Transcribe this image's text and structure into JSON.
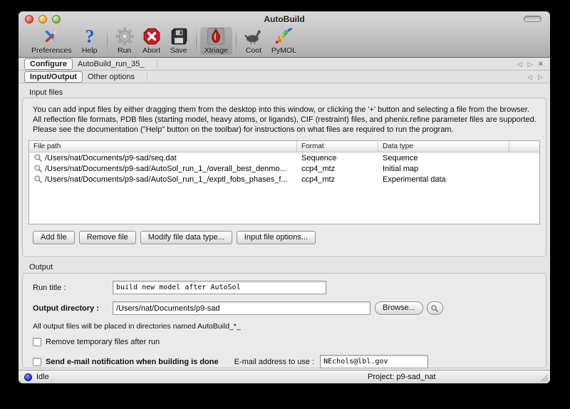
{
  "window": {
    "title": "AutoBuild"
  },
  "toolbar": {
    "items": [
      {
        "label": "Preferences",
        "icon": "preferences-icon"
      },
      {
        "label": "Help",
        "icon": "help-icon"
      },
      {
        "label": "Run",
        "icon": "run-icon"
      },
      {
        "label": "Abort",
        "icon": "abort-icon"
      },
      {
        "label": "Save",
        "icon": "save-icon"
      },
      {
        "label": "Xtriage",
        "icon": "xtriage-icon"
      },
      {
        "label": "Coot",
        "icon": "coot-icon"
      },
      {
        "label": "PyMOL",
        "icon": "pymol-icon"
      }
    ]
  },
  "icons": {
    "tab_prev": "◁",
    "tab_next": "▷",
    "tab_close": "×"
  },
  "tabs": {
    "main": [
      {
        "label": "Configure",
        "selected": true
      },
      {
        "label": "AutoBuild_run_35_",
        "selected": false
      }
    ],
    "sub": [
      {
        "label": "Input/Output",
        "selected": true
      },
      {
        "label": "Other options",
        "selected": false
      }
    ]
  },
  "input_files": {
    "group_label": "Input files",
    "instructions": "You can add input files by either dragging them from the desktop into this window, or clicking the '+' button and selecting a file from the browser. All reflection file formats, PDB files (starting model, heavy atoms, or ligands), CIF (restraint) files, and phenix.refine parameter files are supported.  Please see the documentation (\"Help\" button on the toolbar) for instructions on what files are required to run the program.",
    "table": {
      "columns": [
        "File path",
        "Format",
        "Data type"
      ],
      "rows": [
        {
          "path": "/Users/nat/Documents/p9-sad/seq.dat",
          "format": "Sequence",
          "data_type": "Sequence"
        },
        {
          "path": "/Users/nat/Documents/p9-sad/AutoSol_run_1_/overall_best_denmo...",
          "format": "ccp4_mtz",
          "data_type": "Initial map"
        },
        {
          "path": "/Users/nat/Documents/p9-sad/AutoSol_run_1_/exptl_fobs_phases_f...",
          "format": "ccp4_mtz",
          "data_type": "Experimental data"
        }
      ]
    },
    "buttons": [
      "Add file",
      "Remove file",
      "Modify file data type...",
      "Input file options..."
    ]
  },
  "output": {
    "group_label": "Output",
    "run_title": {
      "label": "Run title :",
      "value": "build new model after AutoSol"
    },
    "output_directory": {
      "label": "Output directory :",
      "value": "/Users/nat/Documents/p9-sad",
      "browse_label": "Browse..."
    },
    "note": "All output files will be placed in directories named AutoBuild_*_",
    "checkboxes": [
      {
        "label": "Remove temporary files after run",
        "checked": false
      },
      {
        "label": "Send e-mail notification when building is done",
        "checked": false
      }
    ],
    "email": {
      "label": "E-mail address to use :",
      "value": "NEchols@lbl.gov"
    }
  },
  "statusbar": {
    "status": "Idle",
    "project": "Project: p9-sad_nat"
  }
}
